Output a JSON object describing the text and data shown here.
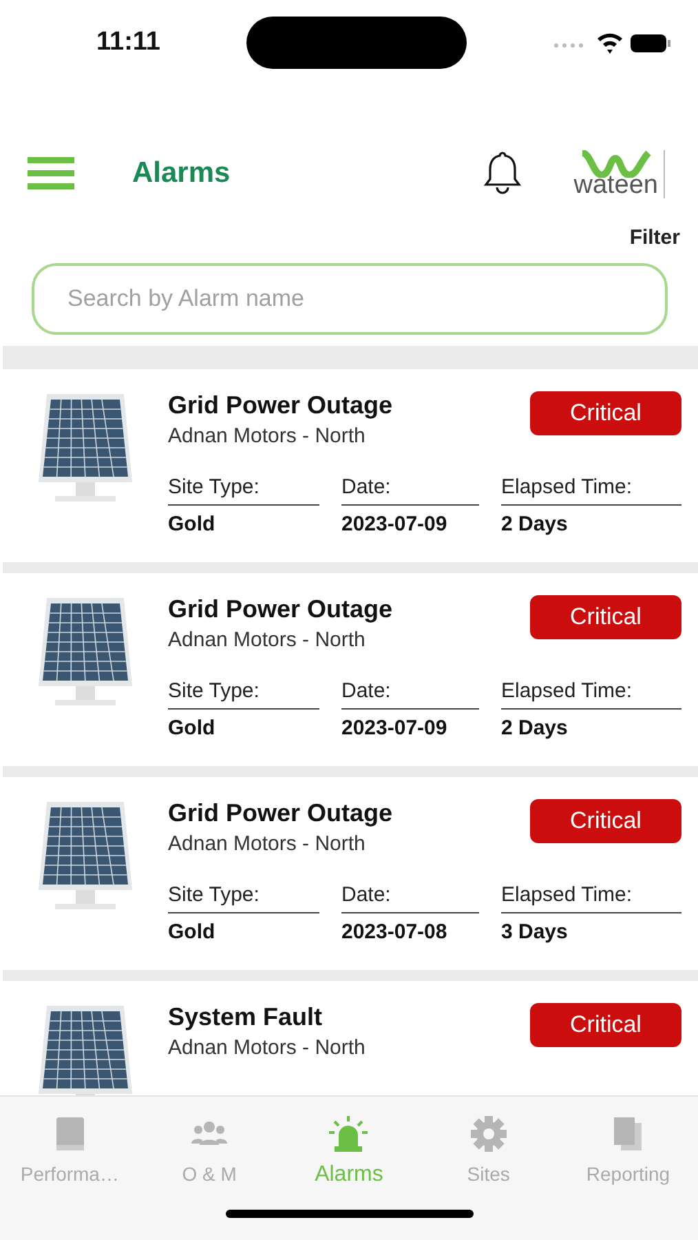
{
  "status_bar": {
    "time": "11:11"
  },
  "header": {
    "title": "Alarms",
    "logo_text": "wateen"
  },
  "filter": {
    "label": "Filter"
  },
  "search": {
    "placeholder": "Search by Alarm name"
  },
  "alarms": [
    {
      "name": "Grid Power Outage",
      "site": "Adnan Motors - North",
      "severity": "Critical",
      "fields": [
        {
          "label": "Site Type:",
          "value": "Gold"
        },
        {
          "label": "Date:",
          "value": "2023-07-09"
        },
        {
          "label": "Elapsed Time:",
          "value": "2 Days"
        }
      ]
    },
    {
      "name": "Grid Power Outage",
      "site": "Adnan Motors - North",
      "severity": "Critical",
      "fields": [
        {
          "label": "Site Type:",
          "value": "Gold"
        },
        {
          "label": "Date:",
          "value": "2023-07-09"
        },
        {
          "label": "Elapsed Time:",
          "value": "2 Days"
        }
      ]
    },
    {
      "name": "Grid Power Outage",
      "site": "Adnan Motors - North",
      "severity": "Critical",
      "fields": [
        {
          "label": "Site Type:",
          "value": "Gold"
        },
        {
          "label": "Date:",
          "value": "2023-07-08"
        },
        {
          "label": "Elapsed Time:",
          "value": "3 Days"
        }
      ]
    },
    {
      "name": "System Fault",
      "site": "Adnan Motors - North",
      "severity": "Critical"
    }
  ],
  "tab_bar": [
    {
      "label": "Performa…",
      "kind": "book",
      "selected": false
    },
    {
      "label": "O & M",
      "kind": "team",
      "selected": false
    },
    {
      "label": "Alarms",
      "kind": "alarm",
      "selected": true
    },
    {
      "label": "Sites",
      "kind": "gear",
      "selected": false
    },
    {
      "label": "Reporting",
      "kind": "docs",
      "selected": false
    }
  ]
}
